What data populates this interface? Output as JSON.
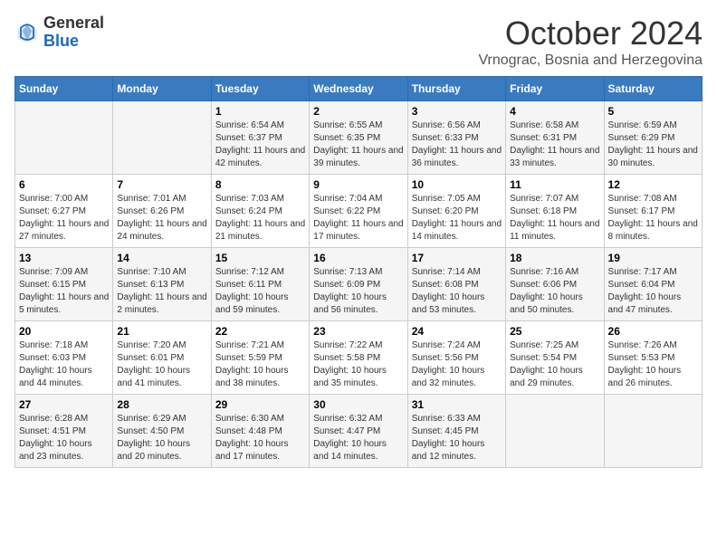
{
  "header": {
    "logo_general": "General",
    "logo_blue": "Blue",
    "month": "October 2024",
    "location": "Vrnograc, Bosnia and Herzegovina"
  },
  "days_of_week": [
    "Sunday",
    "Monday",
    "Tuesday",
    "Wednesday",
    "Thursday",
    "Friday",
    "Saturday"
  ],
  "weeks": [
    [
      {
        "day": "",
        "info": ""
      },
      {
        "day": "",
        "info": ""
      },
      {
        "day": "1",
        "info": "Sunrise: 6:54 AM\nSunset: 6:37 PM\nDaylight: 11 hours and 42 minutes."
      },
      {
        "day": "2",
        "info": "Sunrise: 6:55 AM\nSunset: 6:35 PM\nDaylight: 11 hours and 39 minutes."
      },
      {
        "day": "3",
        "info": "Sunrise: 6:56 AM\nSunset: 6:33 PM\nDaylight: 11 hours and 36 minutes."
      },
      {
        "day": "4",
        "info": "Sunrise: 6:58 AM\nSunset: 6:31 PM\nDaylight: 11 hours and 33 minutes."
      },
      {
        "day": "5",
        "info": "Sunrise: 6:59 AM\nSunset: 6:29 PM\nDaylight: 11 hours and 30 minutes."
      }
    ],
    [
      {
        "day": "6",
        "info": "Sunrise: 7:00 AM\nSunset: 6:27 PM\nDaylight: 11 hours and 27 minutes."
      },
      {
        "day": "7",
        "info": "Sunrise: 7:01 AM\nSunset: 6:26 PM\nDaylight: 11 hours and 24 minutes."
      },
      {
        "day": "8",
        "info": "Sunrise: 7:03 AM\nSunset: 6:24 PM\nDaylight: 11 hours and 21 minutes."
      },
      {
        "day": "9",
        "info": "Sunrise: 7:04 AM\nSunset: 6:22 PM\nDaylight: 11 hours and 17 minutes."
      },
      {
        "day": "10",
        "info": "Sunrise: 7:05 AM\nSunset: 6:20 PM\nDaylight: 11 hours and 14 minutes."
      },
      {
        "day": "11",
        "info": "Sunrise: 7:07 AM\nSunset: 6:18 PM\nDaylight: 11 hours and 11 minutes."
      },
      {
        "day": "12",
        "info": "Sunrise: 7:08 AM\nSunset: 6:17 PM\nDaylight: 11 hours and 8 minutes."
      }
    ],
    [
      {
        "day": "13",
        "info": "Sunrise: 7:09 AM\nSunset: 6:15 PM\nDaylight: 11 hours and 5 minutes."
      },
      {
        "day": "14",
        "info": "Sunrise: 7:10 AM\nSunset: 6:13 PM\nDaylight: 11 hours and 2 minutes."
      },
      {
        "day": "15",
        "info": "Sunrise: 7:12 AM\nSunset: 6:11 PM\nDaylight: 10 hours and 59 minutes."
      },
      {
        "day": "16",
        "info": "Sunrise: 7:13 AM\nSunset: 6:09 PM\nDaylight: 10 hours and 56 minutes."
      },
      {
        "day": "17",
        "info": "Sunrise: 7:14 AM\nSunset: 6:08 PM\nDaylight: 10 hours and 53 minutes."
      },
      {
        "day": "18",
        "info": "Sunrise: 7:16 AM\nSunset: 6:06 PM\nDaylight: 10 hours and 50 minutes."
      },
      {
        "day": "19",
        "info": "Sunrise: 7:17 AM\nSunset: 6:04 PM\nDaylight: 10 hours and 47 minutes."
      }
    ],
    [
      {
        "day": "20",
        "info": "Sunrise: 7:18 AM\nSunset: 6:03 PM\nDaylight: 10 hours and 44 minutes."
      },
      {
        "day": "21",
        "info": "Sunrise: 7:20 AM\nSunset: 6:01 PM\nDaylight: 10 hours and 41 minutes."
      },
      {
        "day": "22",
        "info": "Sunrise: 7:21 AM\nSunset: 5:59 PM\nDaylight: 10 hours and 38 minutes."
      },
      {
        "day": "23",
        "info": "Sunrise: 7:22 AM\nSunset: 5:58 PM\nDaylight: 10 hours and 35 minutes."
      },
      {
        "day": "24",
        "info": "Sunrise: 7:24 AM\nSunset: 5:56 PM\nDaylight: 10 hours and 32 minutes."
      },
      {
        "day": "25",
        "info": "Sunrise: 7:25 AM\nSunset: 5:54 PM\nDaylight: 10 hours and 29 minutes."
      },
      {
        "day": "26",
        "info": "Sunrise: 7:26 AM\nSunset: 5:53 PM\nDaylight: 10 hours and 26 minutes."
      }
    ],
    [
      {
        "day": "27",
        "info": "Sunrise: 6:28 AM\nSunset: 4:51 PM\nDaylight: 10 hours and 23 minutes."
      },
      {
        "day": "28",
        "info": "Sunrise: 6:29 AM\nSunset: 4:50 PM\nDaylight: 10 hours and 20 minutes."
      },
      {
        "day": "29",
        "info": "Sunrise: 6:30 AM\nSunset: 4:48 PM\nDaylight: 10 hours and 17 minutes."
      },
      {
        "day": "30",
        "info": "Sunrise: 6:32 AM\nSunset: 4:47 PM\nDaylight: 10 hours and 14 minutes."
      },
      {
        "day": "31",
        "info": "Sunrise: 6:33 AM\nSunset: 4:45 PM\nDaylight: 10 hours and 12 minutes."
      },
      {
        "day": "",
        "info": ""
      },
      {
        "day": "",
        "info": ""
      }
    ]
  ]
}
